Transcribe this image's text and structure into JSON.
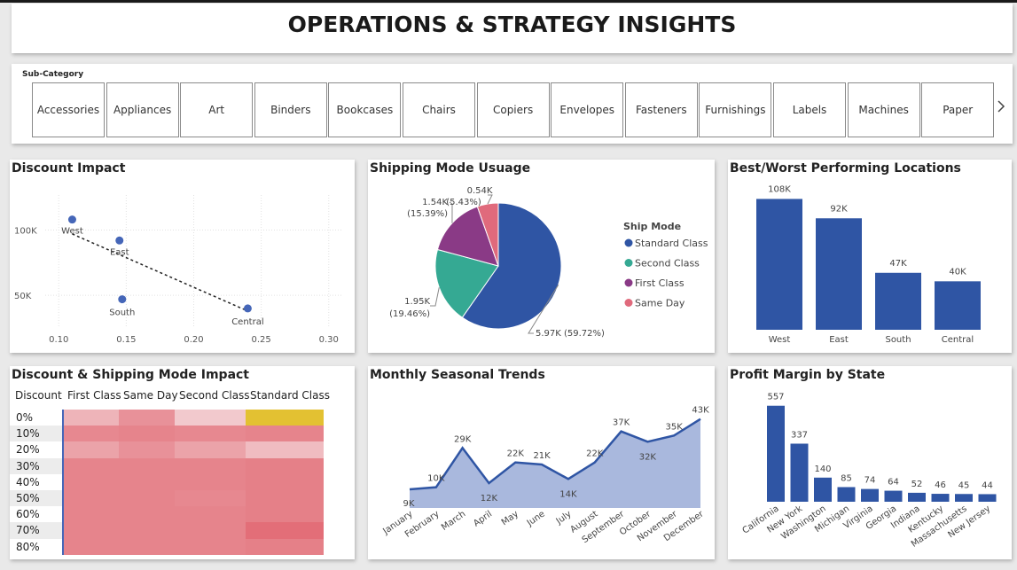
{
  "page_title": "OPERATIONS & STRATEGY INSIGHTS",
  "slicer": {
    "label": "Sub-Category",
    "items": [
      "Accessories",
      "Appliances",
      "Art",
      "Binders",
      "Bookcases",
      "Chairs",
      "Copiers",
      "Envelopes",
      "Fasteners",
      "Furnishings",
      "Labels",
      "Machines",
      "Paper"
    ],
    "next_icon": "chevron-right-icon"
  },
  "colors": {
    "primary": "#2f55a4",
    "teal": "#35a993",
    "purple": "#8a3a86",
    "pink": "#e06a7c",
    "area_fill": "#a9b8dd",
    "heat_high": "#e3c132"
  },
  "chart_data": [
    {
      "type": "scatter",
      "title": "Discount Impact",
      "points": [
        {
          "label": "West",
          "x": 0.11,
          "y": 108000
        },
        {
          "label": "East",
          "x": 0.145,
          "y": 92000
        },
        {
          "label": "South",
          "x": 0.147,
          "y": 47000
        },
        {
          "label": "Central",
          "x": 0.24,
          "y": 40000
        }
      ],
      "x_ticks": [
        "0.10",
        "0.15",
        "0.20",
        "0.25",
        "0.30"
      ],
      "y_ticks": [
        "100K",
        "50K"
      ],
      "xlim": [
        0.09,
        0.31
      ],
      "ylim": [
        25000,
        120000
      ],
      "trendline": {
        "x0": 0.11,
        "y0": 97000,
        "x1": 0.24,
        "y1": 38000
      }
    },
    {
      "type": "pie",
      "title": "Shipping Mode Usuage",
      "legend_title": "Ship Mode",
      "legend_position": "right",
      "slices": [
        {
          "name": "Standard Class",
          "value": 5970,
          "label": "5.97K (59.72%)"
        },
        {
          "name": "Second Class",
          "value": 1950,
          "label_line1": "1.95K",
          "label_line2": "(19.46%)"
        },
        {
          "name": "First Class",
          "value": 1540,
          "label_line1": "1.54K",
          "label_line2": "(15.39%)"
        },
        {
          "name": "Same Day",
          "value": 540,
          "label_line1": "0.54K",
          "label_line2": "(5.43%)"
        }
      ]
    },
    {
      "type": "bar",
      "title": "Best/Worst Performing Locations",
      "categories": [
        "West",
        "East",
        "South",
        "Central"
      ],
      "values": [
        108000,
        92000,
        47000,
        40000
      ],
      "data_labels": [
        "108K",
        "92K",
        "47K",
        "40K"
      ],
      "ylim": [
        0,
        120000
      ]
    },
    {
      "type": "heatmap",
      "title": "Discount & Shipping Mode Impact",
      "row_header": "Discount",
      "columns": [
        "First Class",
        "Same Day",
        "Second Class",
        "Standard Class"
      ],
      "rows": [
        "0%",
        "10%",
        "20%",
        "30%",
        "40%",
        "50%",
        "60%",
        "70%",
        "80%"
      ],
      "intensity": [
        [
          0.35,
          0.55,
          0.2,
          1.0
        ],
        [
          0.6,
          0.62,
          0.6,
          0.62
        ],
        [
          0.45,
          0.55,
          0.45,
          0.3
        ],
        [
          0.62,
          0.62,
          0.62,
          0.66
        ],
        [
          0.62,
          0.62,
          0.62,
          0.66
        ],
        [
          0.62,
          0.62,
          0.6,
          0.66
        ],
        [
          0.62,
          0.62,
          0.62,
          0.66
        ],
        [
          0.62,
          0.62,
          0.62,
          0.75
        ],
        [
          0.62,
          0.62,
          0.62,
          0.66
        ]
      ]
    },
    {
      "type": "area",
      "title": "Monthly Seasonal Trends",
      "categories": [
        "January",
        "February",
        "March",
        "April",
        "May",
        "June",
        "July",
        "August",
        "September",
        "October",
        "November",
        "December"
      ],
      "values": [
        9000,
        10000,
        29000,
        12000,
        22000,
        21000,
        14000,
        22000,
        37000,
        32000,
        35000,
        43000
      ],
      "data_labels": [
        "9K",
        "10K",
        "29K",
        "12K",
        "22K",
        "21K",
        "14K",
        "22K",
        "37K",
        "32K",
        "35K",
        "43K"
      ],
      "ylim": [
        0,
        48000
      ]
    },
    {
      "type": "bar",
      "title": "Profit Margin by State",
      "categories": [
        "California",
        "New York",
        "Washington",
        "Michigan",
        "Virginia",
        "Georgia",
        "Indiana",
        "Kentucky",
        "Massachusetts",
        "New Jersey"
      ],
      "values": [
        557,
        337,
        140,
        85,
        74,
        64,
        52,
        46,
        45,
        44
      ],
      "data_labels": [
        "557",
        "337",
        "140",
        "85",
        "74",
        "64",
        "52",
        "46",
        "45",
        "44"
      ],
      "ylim": [
        0,
        600
      ]
    }
  ]
}
